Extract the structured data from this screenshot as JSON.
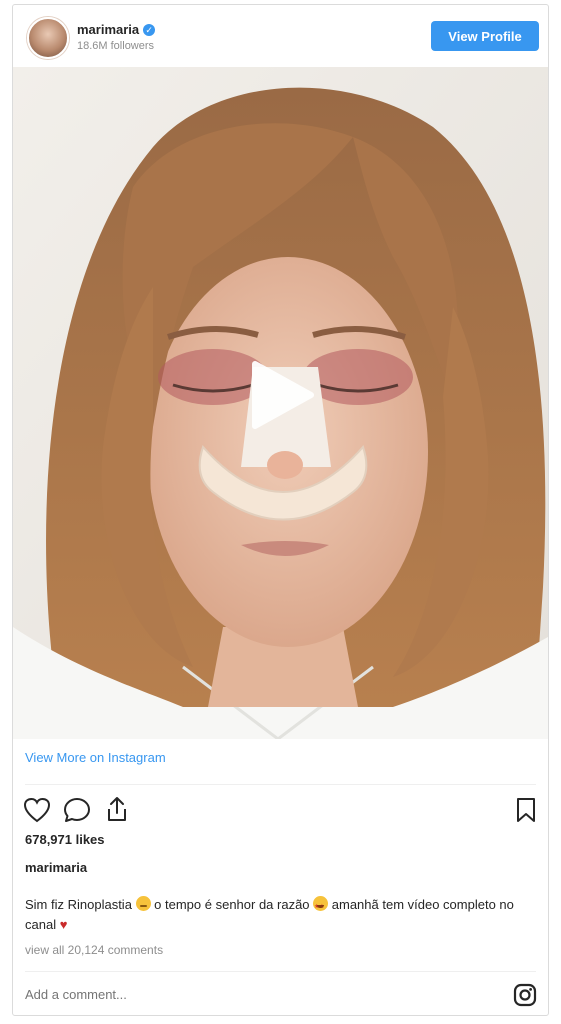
{
  "header": {
    "username": "marimaria",
    "followers": "18.6M followers",
    "view_profile_label": "View Profile"
  },
  "media": {
    "type": "video",
    "overlay_icon": "play-icon"
  },
  "links": {
    "view_more": "View More on Instagram"
  },
  "actions": {
    "icons": [
      "heart-icon",
      "comment-icon",
      "share-icon",
      "bookmark-icon"
    ]
  },
  "stats": {
    "likes": "678,971 likes"
  },
  "caption": {
    "username": "marimaria",
    "part1": "Sim fiz Rinoplastia ",
    "part2": " o tempo é senhor da razão ",
    "part3": " amanhã tem vídeo completo no canal "
  },
  "comments": {
    "view_all": "view all 20,124 comments"
  },
  "comment_box": {
    "placeholder": "Add a comment..."
  },
  "colors": {
    "accent": "#3897f0",
    "text": "#262626",
    "muted": "#8e8e8e",
    "border": "#dbdbdb"
  }
}
